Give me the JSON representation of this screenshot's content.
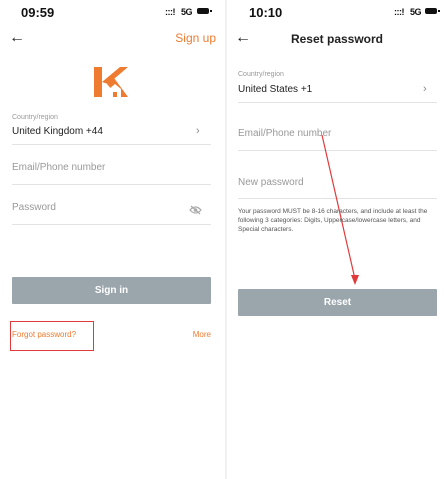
{
  "login_screen": {
    "status": {
      "time": "09:59",
      "network": "5G"
    },
    "header": {
      "signup_label": "Sign up"
    },
    "country": {
      "label": "Country/region",
      "value": "United Kingdom +44"
    },
    "email_placeholder": "Email/Phone number",
    "password_placeholder": "Password",
    "signin_label": "Sign in",
    "forgot_label": "Forgot password?",
    "more_label": "More"
  },
  "reset_screen": {
    "status": {
      "time": "10:10",
      "network": "5G"
    },
    "header": {
      "title": "Reset password"
    },
    "country": {
      "label": "Country/region",
      "value": "United States +1"
    },
    "email_placeholder": "Email/Phone number",
    "new_password_placeholder": "New password",
    "password_hint": "Your password MUST be 8-16 characters, and include at least the following 3 categories: Digits, Uppercase/lowercase letters, and Special characters.",
    "reset_label": "Reset"
  },
  "colors": {
    "accent": "#ee7b30",
    "button": "#9aa5ac",
    "annotation": "#e03a3a"
  },
  "icons": [
    "back-arrow-icon",
    "brand-logo-icon",
    "chevron-right-icon",
    "eye-off-icon",
    "signal-icon",
    "battery-icon"
  ]
}
